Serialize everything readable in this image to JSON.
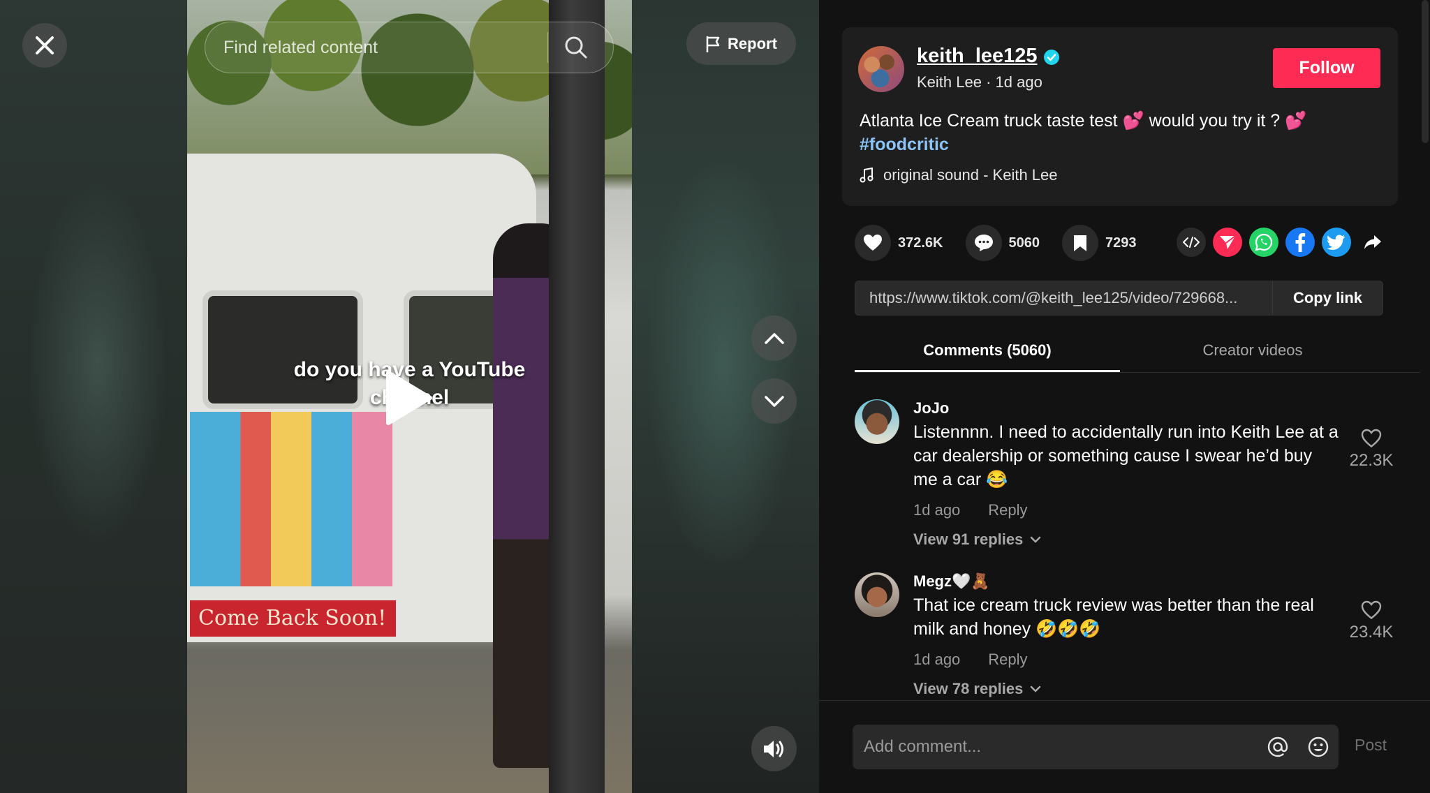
{
  "video": {
    "caption_line1": "do you have a YouTube",
    "caption_line2": "channel",
    "truck_banner": "Come Back Soon!"
  },
  "search": {
    "placeholder": "Find related content"
  },
  "report": {
    "label": "Report"
  },
  "author": {
    "username": "keith_lee125",
    "display_name": "Keith Lee",
    "separator": " · ",
    "posted": "1d ago",
    "follow_label": "Follow"
  },
  "post": {
    "description": "Atlanta Ice Cream truck taste test 💕 would you try it ? 💕",
    "hashtag": "#foodcritic",
    "sound": "original sound - Keith Lee"
  },
  "stats": {
    "likes": "372.6K",
    "comments": "5060",
    "saves": "7293"
  },
  "share": {
    "icons": [
      "embed-icon",
      "tiktok-send-icon",
      "whatsapp-icon",
      "facebook-icon",
      "twitter-icon",
      "share-arrow-icon"
    ],
    "colors": {
      "send": "#fe2c55",
      "whatsapp": "#25d366",
      "facebook": "#1877f2",
      "twitter": "#1d9bf0"
    }
  },
  "link": {
    "url": "https://www.tiktok.com/@keith_lee125/video/729668...",
    "copy_label": "Copy link"
  },
  "tabs": [
    {
      "label": "Comments (5060)",
      "active": true
    },
    {
      "label": "Creator videos",
      "active": false
    }
  ],
  "comments": [
    {
      "name": "JoJo",
      "text": "Listennnn. I need to accidentally run into Keith Lee at a car dealership or something cause I swear he’d buy me a car 😂",
      "time": "1d ago",
      "reply_label": "Reply",
      "likes": "22.3K",
      "view_replies": "View 91 replies"
    },
    {
      "name": "Megz🤍🧸",
      "text": "That ice cream truck review was better than the real milk and honey 🤣🤣🤣",
      "time": "1d ago",
      "reply_label": "Reply",
      "likes": "23.4K",
      "view_replies": "View 78 replies"
    }
  ],
  "composer": {
    "placeholder": "Add comment...",
    "post_label": "Post"
  },
  "colors": {
    "accent": "#fe2c55",
    "hashtag": "#8cc4f8",
    "verified": "#20d5ec"
  }
}
